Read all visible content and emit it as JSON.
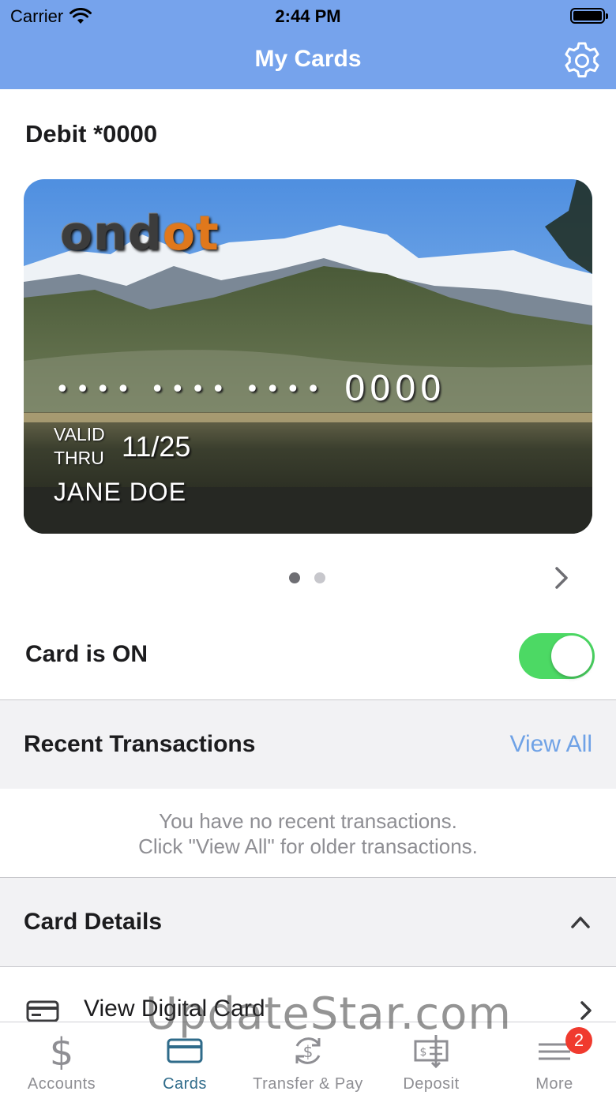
{
  "status_bar": {
    "carrier": "Carrier",
    "time": "2:44 PM"
  },
  "nav": {
    "title": "My Cards"
  },
  "card": {
    "title": "Debit *0000",
    "brand_main": "ond",
    "brand_accent": "ot",
    "number_masked": "•••• •••• ••••",
    "number_last4": "0000",
    "valid_label_1": "VALID",
    "valid_label_2": "THRU",
    "expiry": "11/25",
    "holder": "JANE DOE",
    "pages": 2,
    "current_page": 1
  },
  "toggle": {
    "label": "Card is ON",
    "on": true
  },
  "recent": {
    "title": "Recent Transactions",
    "view_all": "View All",
    "empty_line1": "You have no recent transactions.",
    "empty_line2": "Click \"View All\" for older transactions."
  },
  "details": {
    "title": "Card Details",
    "rows": [
      {
        "label": "View Digital Card"
      }
    ]
  },
  "tabs": [
    {
      "label": "Accounts"
    },
    {
      "label": "Cards"
    },
    {
      "label": "Transfer & Pay"
    },
    {
      "label": "Deposit"
    },
    {
      "label": "More",
      "badge": "2"
    }
  ],
  "active_tab": "Cards",
  "watermark": "UpdateStar.com",
  "colors": {
    "nav": "#76a3ec",
    "toggle_on": "#4cd964",
    "link": "#6fa2e6",
    "badge": "#f03a2e",
    "active_tab": "#2f6b8a"
  }
}
